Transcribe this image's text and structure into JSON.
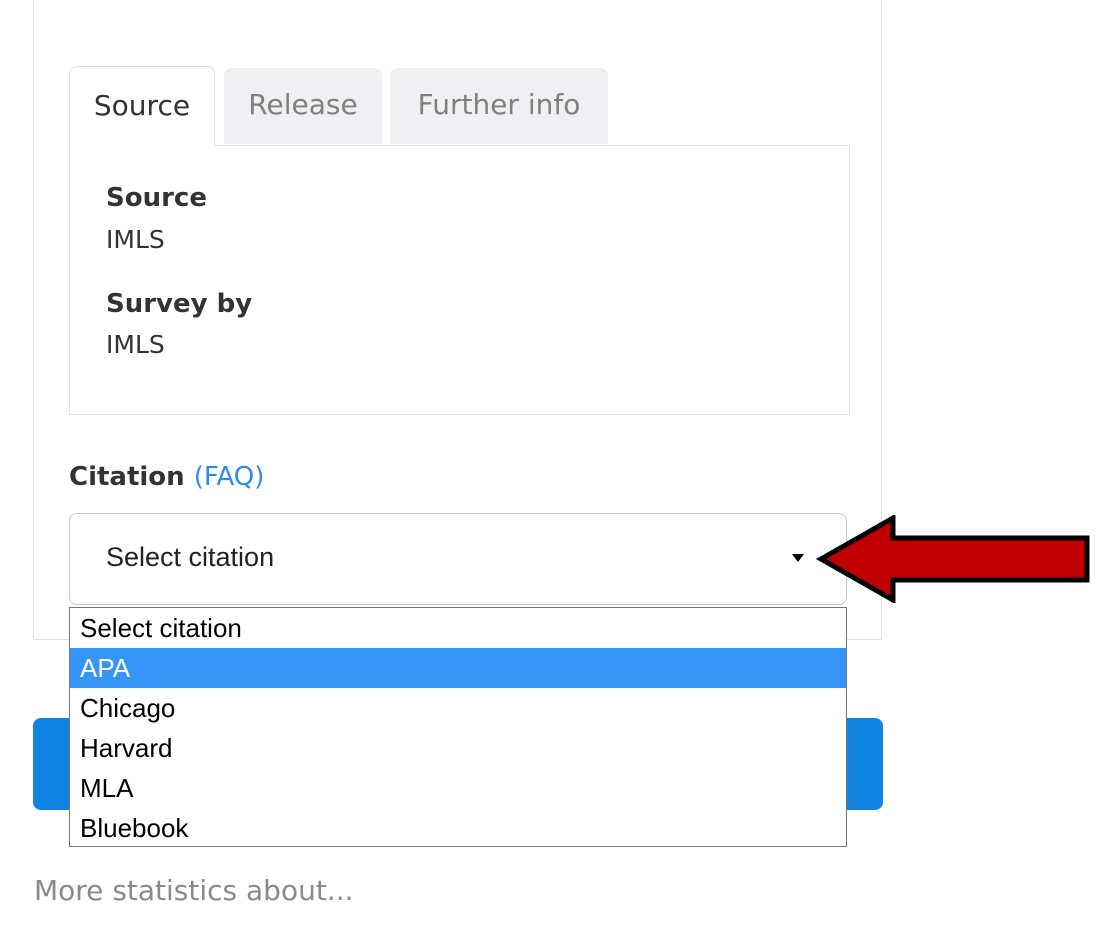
{
  "tabs": [
    {
      "label": "Source",
      "active": true
    },
    {
      "label": "Release",
      "active": false
    },
    {
      "label": "Further info",
      "active": false
    }
  ],
  "source_panel": {
    "source_label": "Source",
    "source_value": "IMLS",
    "survey_label": "Survey by",
    "survey_value": "IMLS"
  },
  "citation": {
    "label": "Citation",
    "faq_link": "(FAQ)",
    "select_value": "Select citation",
    "options": [
      "Select citation",
      "APA",
      "Chicago",
      "Harvard",
      "MLA",
      "Bluebook"
    ],
    "highlighted_option": "APA"
  },
  "more_statistics_link": "More statistics about...",
  "colors": {
    "accent_blue": "#1083e3",
    "highlight_blue": "#3596f7",
    "link_blue": "#2e8bea",
    "annotation_arrow": "#c00000"
  },
  "icons": {
    "dropdown": "caret-down-icon",
    "annotation": "red-arrow-icon"
  }
}
